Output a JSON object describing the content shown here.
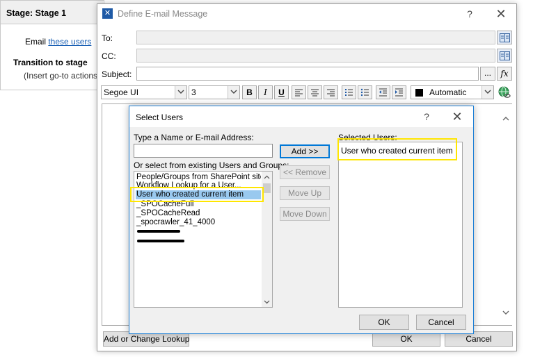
{
  "stage": {
    "title": "Stage: Stage 1",
    "email_prefix": "Email ",
    "email_link": "these users",
    "transition_heading": "Transition to stage",
    "transition_placeholder": "(Insert go-to actions"
  },
  "email_dialog": {
    "title": "Define E-mail Message",
    "help": "?",
    "close": "✕",
    "to_label": "To:",
    "cc_label": "CC:",
    "subject_label": "Subject:",
    "subject_more": "...",
    "subject_fx": "fx",
    "toolbar": {
      "font": "Segoe UI",
      "size": "3",
      "bold": "B",
      "italic": "I",
      "underline": "U",
      "color_label": "Automatic"
    },
    "lookup_button": "Add or Change Lookup",
    "ok_button": "OK",
    "cancel_button": "Cancel"
  },
  "select_users": {
    "title": "Select Users",
    "help": "?",
    "close": "✕",
    "type_name_label": "Type a Name or E-mail Address:",
    "name_value": "",
    "or_select_label": "Or select from existing Users and Groups:",
    "list_items": [
      "People/Groups from SharePoint site...",
      "Workflow Lookup for a User...",
      "User who created current item",
      "_SPOCacheFull",
      "_SPOCacheRead",
      "_spocrawler_41_4000"
    ],
    "add_button": "Add >>",
    "remove_button": "<< Remove",
    "move_up_button": "Move Up",
    "move_down_button": "Move Down",
    "selected_label": "Selected Users:",
    "selected_items": [
      "User who created current item"
    ],
    "ok_button": "OK",
    "cancel_button": "Cancel"
  },
  "colors": {
    "highlight": "#ffe600",
    "selection": "#99c9ef",
    "dialog_border": "#1c7fd6",
    "link": "#1a5fb4"
  }
}
